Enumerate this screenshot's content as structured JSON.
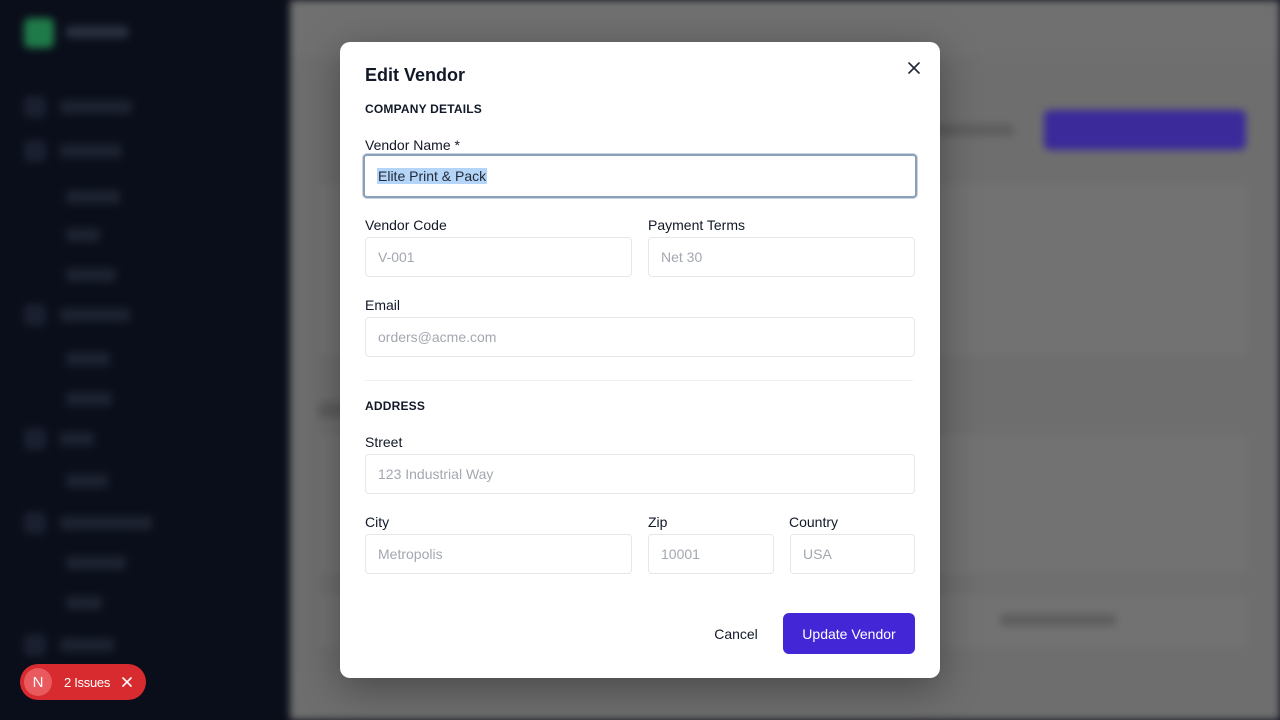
{
  "modal": {
    "title": "Edit Vendor",
    "company_section": "COMPANY DETAILS",
    "address_section": "ADDRESS",
    "fields": {
      "vendor_name": {
        "label": "Vendor Name *",
        "value": "Elite Print & Pack"
      },
      "vendor_code": {
        "label": "Vendor Code",
        "placeholder": "V-001"
      },
      "payment_terms": {
        "label": "Payment Terms",
        "placeholder": "Net 30"
      },
      "email": {
        "label": "Email",
        "placeholder": "orders@acme.com"
      },
      "street": {
        "label": "Street",
        "placeholder": "123 Industrial Way"
      },
      "city": {
        "label": "City",
        "placeholder": "Metropolis"
      },
      "zip": {
        "label": "Zip",
        "placeholder": "10001"
      },
      "country": {
        "label": "Country",
        "placeholder": "USA"
      }
    },
    "cancel_label": "Cancel",
    "submit_label": "Update Vendor"
  },
  "issues_badge": {
    "letter": "N",
    "text": "2 Issues"
  },
  "colors": {
    "primary": "#4327d6",
    "issues": "#d82b30",
    "overlay": "#6e6e6e"
  }
}
